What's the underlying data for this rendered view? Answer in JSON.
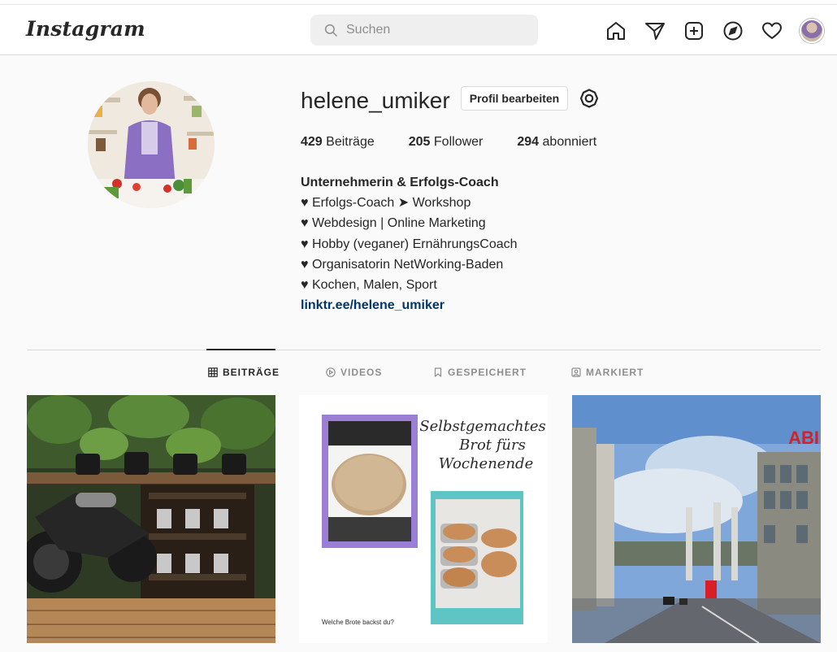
{
  "header": {
    "logo": "Instagram",
    "search_placeholder": "Suchen",
    "nav_icons": [
      "home-icon",
      "direct-icon",
      "new-post-icon",
      "explore-icon",
      "activity-icon",
      "avatar"
    ]
  },
  "profile": {
    "username": "helene_umiker",
    "edit_button": "Profil bearbeiten",
    "stats": {
      "posts_count": "429",
      "posts_label": "Beiträge",
      "followers_count": "205",
      "followers_label": "Follower",
      "following_count": "294",
      "following_label": "abonniert"
    },
    "bio": {
      "name": "Unternehmerin & Erfolgs-Coach",
      "lines": [
        "♥ Erfolgs-Coach ➤ Workshop",
        "♥ Webdesign | Online Marketing",
        "♥ Hobby (veganer) ErnährungsCoach",
        "♥ Organisatorin NetWorking-Baden",
        "♥ Kochen, Malen, Sport"
      ],
      "link": "linktr.ee/helene_umiker"
    }
  },
  "tabs": [
    {
      "label": "BEITRÄGE",
      "icon": "grid-icon",
      "active": true
    },
    {
      "label": "VIDEOS",
      "icon": "play-icon",
      "active": false
    },
    {
      "label": "GESPEICHERT",
      "icon": "bookmark-icon",
      "active": false
    },
    {
      "label": "MARKIERT",
      "icon": "tagged-icon",
      "active": false
    }
  ],
  "posts": {
    "post2": {
      "title_line1": "Selbstgemachtes",
      "title_line2": "Brot fürs",
      "title_line3": "Wochenende",
      "caption": "Welche Brote backst du?"
    },
    "post3": {
      "sign_text": "ABI"
    }
  },
  "colors": {
    "link": "#00376b",
    "text": "#262626",
    "muted": "#8e8e8e",
    "border": "#dbdbdb",
    "post2_purple": "#9b7fd4",
    "post2_teal": "#5ec4c4"
  }
}
